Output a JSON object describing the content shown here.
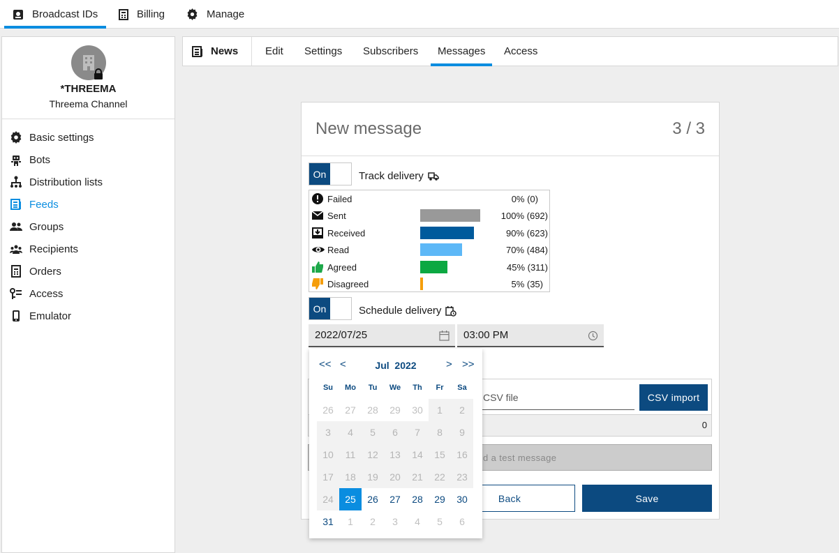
{
  "topnav": [
    {
      "label": "Broadcast IDs",
      "icon": "broadcast-icon"
    },
    {
      "label": "Billing",
      "icon": "billing-icon"
    },
    {
      "label": "Manage",
      "icon": "gear-icon"
    }
  ],
  "profile": {
    "name": "*THREEMA",
    "subtitle": "Threema Channel"
  },
  "sidebar": {
    "items": [
      {
        "label": "Basic settings",
        "icon": "gear-icon"
      },
      {
        "label": "Bots",
        "icon": "robot-icon"
      },
      {
        "label": "Distribution lists",
        "icon": "hierarchy-icon"
      },
      {
        "label": "Feeds",
        "icon": "feed-icon"
      },
      {
        "label": "Groups",
        "icon": "group-icon"
      },
      {
        "label": "Recipients",
        "icon": "recipients-icon"
      },
      {
        "label": "Orders",
        "icon": "orders-icon"
      },
      {
        "label": "Access",
        "icon": "key-icon"
      },
      {
        "label": "Emulator",
        "icon": "phone-icon"
      }
    ]
  },
  "subtabs": {
    "feed_name": "News",
    "tabs": [
      "Edit",
      "Settings",
      "Subscribers",
      "Messages",
      "Access"
    ],
    "active": "Messages"
  },
  "card": {
    "title": "New message",
    "step": "3 / 3"
  },
  "track": {
    "toggle": "On",
    "label": "Track delivery"
  },
  "stats": [
    {
      "label": "Failed",
      "value": "0% (0)",
      "fraction": 0.0,
      "color": "#1a1a1a"
    },
    {
      "label": "Sent",
      "value": "100% (692)",
      "fraction": 1.0,
      "color": "#999999"
    },
    {
      "label": "Received",
      "value": "90% (623)",
      "fraction": 0.9,
      "color": "#005a9c"
    },
    {
      "label": "Read",
      "value": "70% (484)",
      "fraction": 0.7,
      "color": "#5db8f7"
    },
    {
      "label": "Agreed",
      "value": "45% (311)",
      "fraction": 0.45,
      "color": "#0ca842"
    },
    {
      "label": "Disagreed",
      "value": "5% (35)",
      "fraction": 0.05,
      "color": "#f59e0b"
    }
  ],
  "schedule": {
    "toggle": "On",
    "label": "Schedule delivery",
    "date": "2022/07/25",
    "time": "03:00 PM"
  },
  "csv": {
    "placeholder": "CSV file",
    "button": "CSV import",
    "count": "0"
  },
  "test_button": "d a test message",
  "buttons": {
    "back": "Back",
    "save": "Save"
  },
  "datepicker": {
    "month": "Jul",
    "year": "2022",
    "weekdays": [
      "Su",
      "Mo",
      "Tu",
      "We",
      "Th",
      "Fr",
      "Sa"
    ],
    "weeks": [
      [
        "26",
        "27",
        "28",
        "29",
        "30",
        "1",
        "2"
      ],
      [
        "3",
        "4",
        "5",
        "6",
        "7",
        "8",
        "9"
      ],
      [
        "10",
        "11",
        "12",
        "13",
        "14",
        "15",
        "16"
      ],
      [
        "17",
        "18",
        "19",
        "20",
        "21",
        "22",
        "23"
      ],
      [
        "24",
        "25",
        "26",
        "27",
        "28",
        "29",
        "30"
      ],
      [
        "31",
        "1",
        "2",
        "3",
        "4",
        "5",
        "6"
      ]
    ],
    "selected": "25",
    "nav": [
      "<<",
      "<",
      ">",
      ">>"
    ]
  }
}
